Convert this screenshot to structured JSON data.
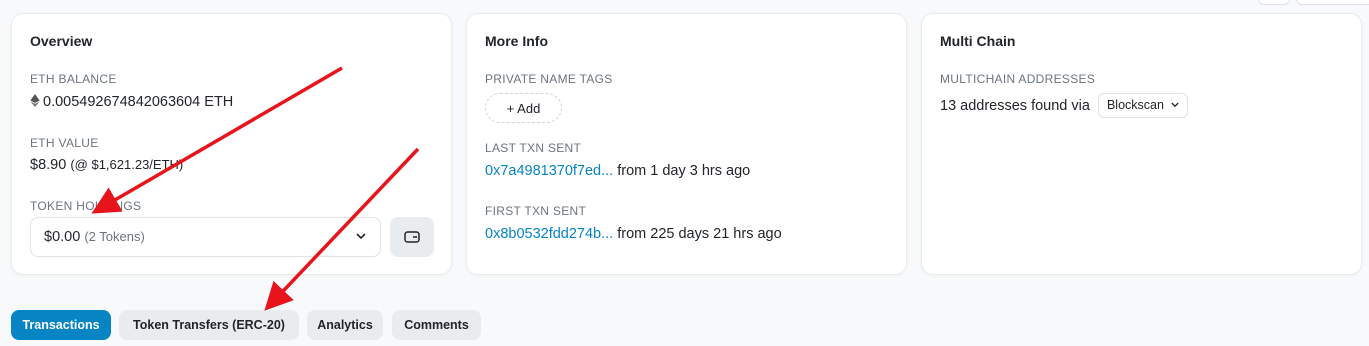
{
  "overview": {
    "title": "Overview",
    "eth_balance_label": "ETH BALANCE",
    "eth_balance_value": "0.005492674842063604 ETH",
    "eth_value_label": "ETH VALUE",
    "eth_value_amount": "$8.90",
    "eth_value_price": "(@ $1,621.23/ETH)",
    "token_holdings_label": "TOKEN HOLDINGS",
    "token_holdings_value": "$0.00",
    "token_holdings_count": "(2 Tokens)"
  },
  "more_info": {
    "title": "More Info",
    "private_name_tags_label": "PRIVATE NAME TAGS",
    "add_label": "+ Add",
    "last_txn_label": "LAST TXN SENT",
    "last_txn_hash": "0x7a4981370f7ed...",
    "last_txn_time": "from 1 day 3 hrs ago",
    "first_txn_label": "FIRST TXN SENT",
    "first_txn_hash": "0x8b0532fdd274b...",
    "first_txn_time": "from 225 days 21 hrs ago"
  },
  "multi_chain": {
    "title": "Multi Chain",
    "addresses_label": "MULTICHAIN ADDRESSES",
    "addresses_text": "13 addresses found via",
    "blockscan_label": "Blockscan"
  },
  "tabs": [
    {
      "label": "Transactions",
      "active": true
    },
    {
      "label": "Token Transfers (ERC-20)",
      "active": false
    },
    {
      "label": "Analytics",
      "active": false
    },
    {
      "label": "Comments",
      "active": false
    }
  ],
  "colors": {
    "accent": "#0784c3",
    "annotation_arrow": "#e8141b",
    "background": "#f8f9fa",
    "card": "#ffffff"
  },
  "icons": {
    "eth": "eth-diamond-icon",
    "chevron": "chevron-down-icon",
    "wallet": "wallet-icon"
  }
}
